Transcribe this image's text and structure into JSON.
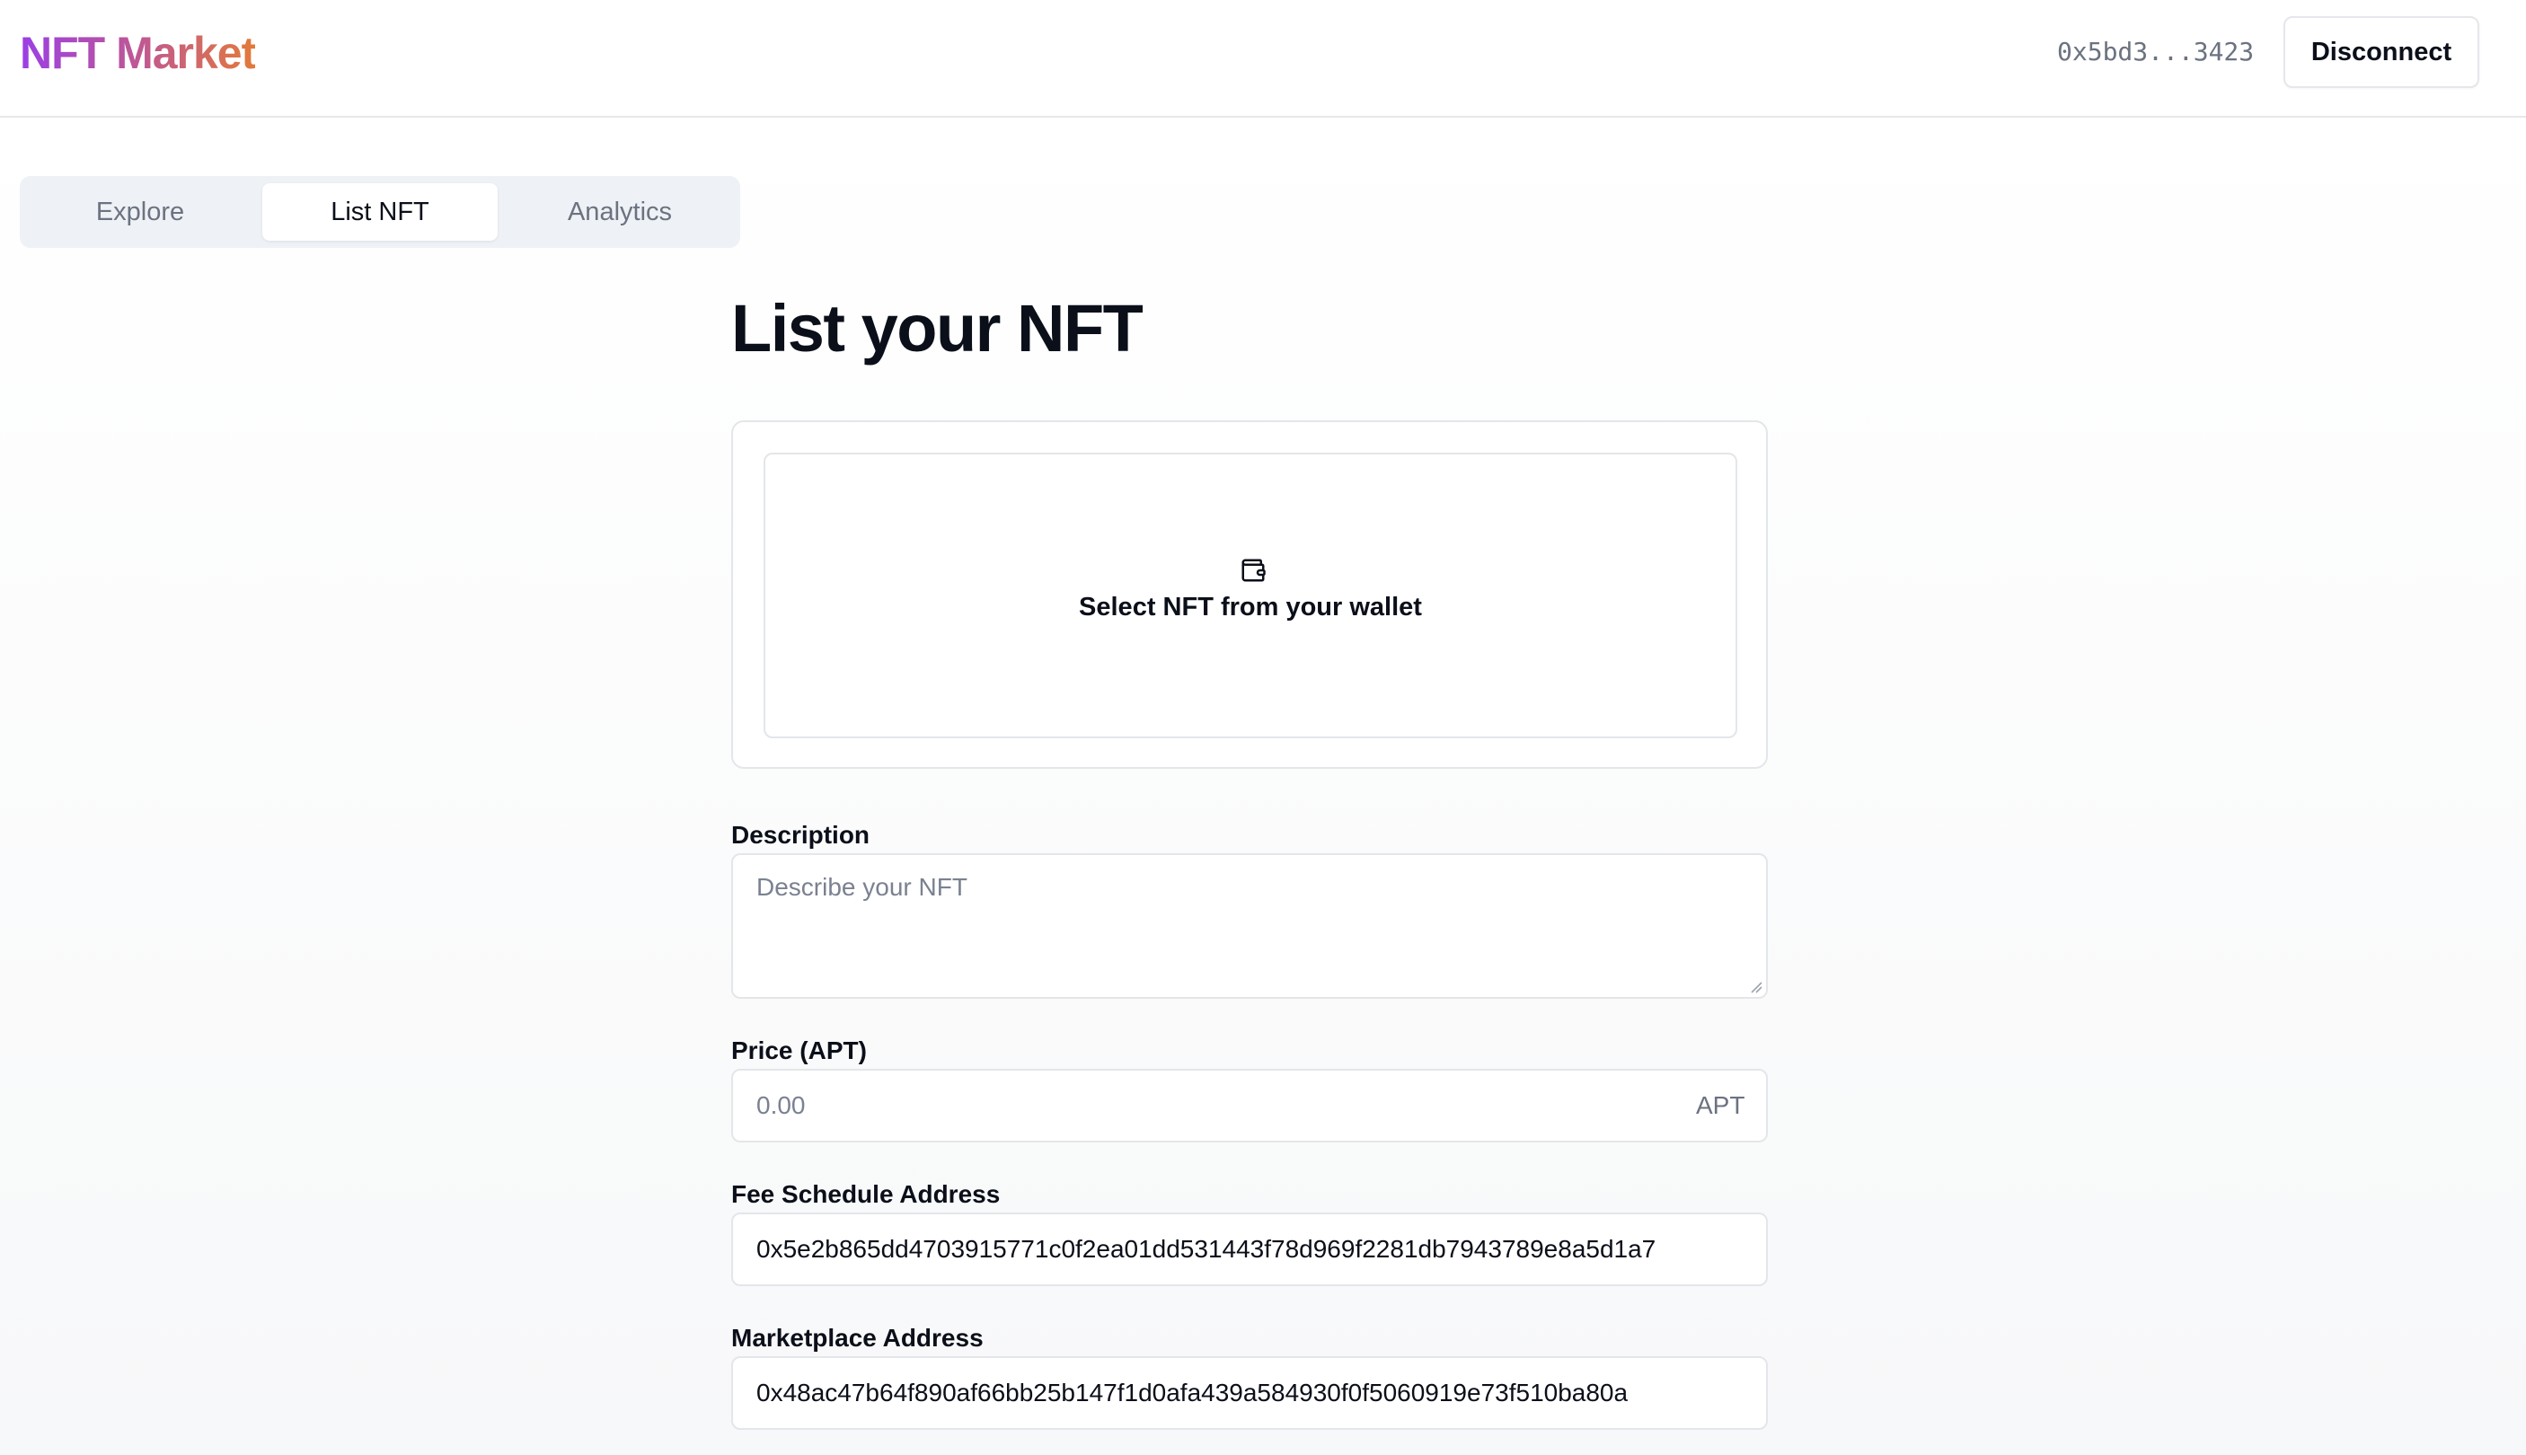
{
  "app": {
    "logo": "NFT Market",
    "wallet_address": "0x5bd3...3423",
    "disconnect_label": "Disconnect"
  },
  "tabs": [
    {
      "label": "Explore",
      "active": false
    },
    {
      "label": "List NFT",
      "active": true
    },
    {
      "label": "Analytics",
      "active": false
    }
  ],
  "form": {
    "title": "List your NFT",
    "nft_select_label": "Select NFT from your wallet",
    "nft_select_icon": "wallet-icon",
    "description": {
      "label": "Description",
      "placeholder": "Describe your NFT",
      "value": ""
    },
    "price": {
      "label": "Price (APT)",
      "placeholder": "0.00",
      "value": "",
      "unit": "APT"
    },
    "fee_schedule": {
      "label": "Fee Schedule Address",
      "value": "0x5e2b865dd4703915771c0f2ea01dd531443f78d969f2281db7943789e8a5d1a7"
    },
    "marketplace": {
      "label": "Marketplace Address",
      "value": "0x48ac47b64f890af66bb25b147f1d0afa439a584930f0f5060919e73f510ba80a"
    }
  },
  "colors": {
    "logo_gradient_start": "#9b3fe6",
    "logo_gradient_end": "#e27a3a",
    "text_primary": "#0b0f19",
    "text_muted": "#6b7280",
    "border": "#e3e6ea",
    "tabs_bg": "#eef1f5"
  }
}
